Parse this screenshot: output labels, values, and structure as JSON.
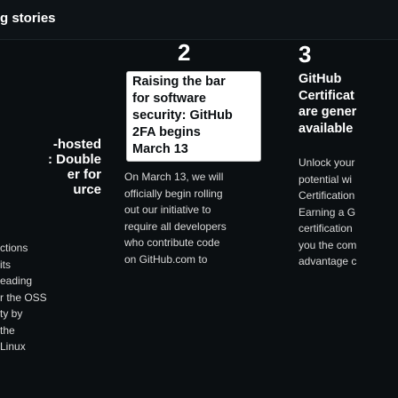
{
  "header": {
    "title": "g stories"
  },
  "cards": [
    {
      "title_lines": [
        "-hosted",
        ": Double",
        "er for",
        "urce"
      ],
      "desc_lines": [
        "ctions",
        "its",
        "eading",
        "r the OSS",
        "ty by",
        "the",
        "Linux"
      ]
    },
    {
      "number": "2",
      "banner_lines": [
        "Raising the bar",
        "for software",
        "security: GitHub",
        "2FA begins",
        "March 13"
      ],
      "desc_lines": [
        "On March 13, we will",
        "officially begin rolling",
        "out our initiative to",
        "require all developers",
        "who contribute code",
        "on GitHub.com to"
      ]
    },
    {
      "number": "3",
      "title_lines": [
        "GitHub",
        "Certificat",
        "are gener",
        "available"
      ],
      "desc_lines": [
        "Unlock your",
        "potential wi",
        "Certification",
        "Earning a G",
        "certification",
        "you the com",
        "advantage c"
      ]
    }
  ]
}
